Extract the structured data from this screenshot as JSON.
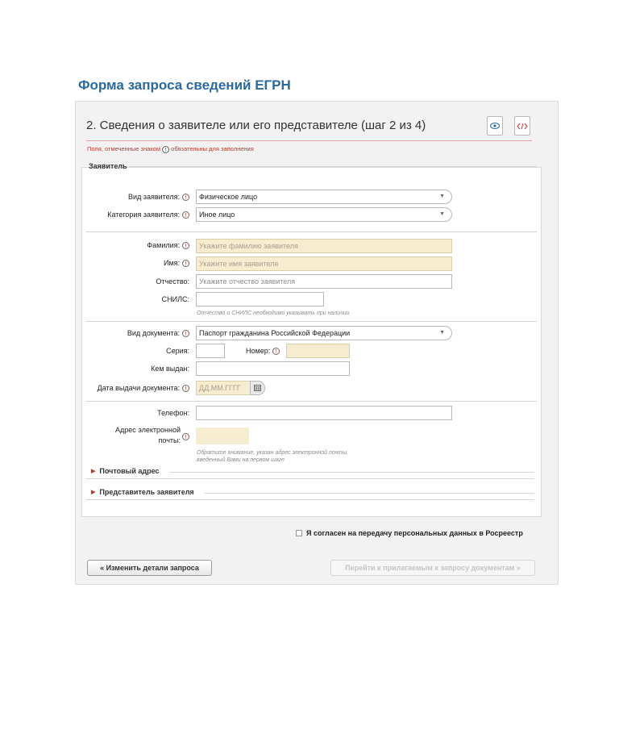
{
  "page": {
    "title": "Форма запроса сведений ЕГРН"
  },
  "step": {
    "title": "2. Сведения о заявителе или его представителе (шаг 2 из 4)",
    "icons": [
      "preview-icon",
      "xml-code-icon"
    ]
  },
  "required_note": {
    "before": "Поля, отмеченные знаком",
    "after": "обязательны для заполнения",
    "icon": "info-icon"
  },
  "section": {
    "title": "Заявитель"
  },
  "fields": {
    "applicant_type": {
      "label": "Вид заявителя:",
      "value": "Физическое лицо"
    },
    "applicant_category": {
      "label": "Категория заявителя:",
      "value": "Иное лицо"
    },
    "surname": {
      "label": "Фамилия:",
      "placeholder": "Укажите фамилию заявителя"
    },
    "name": {
      "label": "Имя:",
      "placeholder": "Укажите имя заявителя"
    },
    "patronymic": {
      "label": "Отчество:",
      "placeholder": "Укажите отчество заявителя"
    },
    "snils": {
      "label": "СНИЛС:",
      "value": ""
    },
    "snils_hint": "Отчество и СНИЛС необходимо указывать при наличии",
    "doc_type": {
      "label": "Вид документа:",
      "value": "Паспорт гражданина Российской Федерации"
    },
    "series": {
      "label": "Серия:",
      "value": ""
    },
    "number": {
      "label": "Номер:",
      "value": ""
    },
    "issued_by": {
      "label": "Кем выдан:",
      "value": ""
    },
    "issue_date": {
      "label": "Дата выдачи документа:",
      "placeholder": "ДД.ММ.ГГГГ"
    },
    "phone": {
      "label": "Телефон:",
      "value": ""
    },
    "email": {
      "label_line1": "Адрес электронной",
      "label_line2": "почты:",
      "value": ""
    },
    "email_hint_line1": "Обратите внимание, указан адрес электронной почты,",
    "email_hint_line2": "введенный Вами на первом шаге"
  },
  "collapsibles": {
    "postal": "Почтовый адрес",
    "representative": "Представитель заявителя"
  },
  "consent": {
    "label": "Я согласен на передачу персональных данных в Росреестр",
    "checked": false
  },
  "buttons": {
    "back": "« Изменить детали запроса",
    "next": "Перейти к прилагаемым к запросу документам »"
  }
}
